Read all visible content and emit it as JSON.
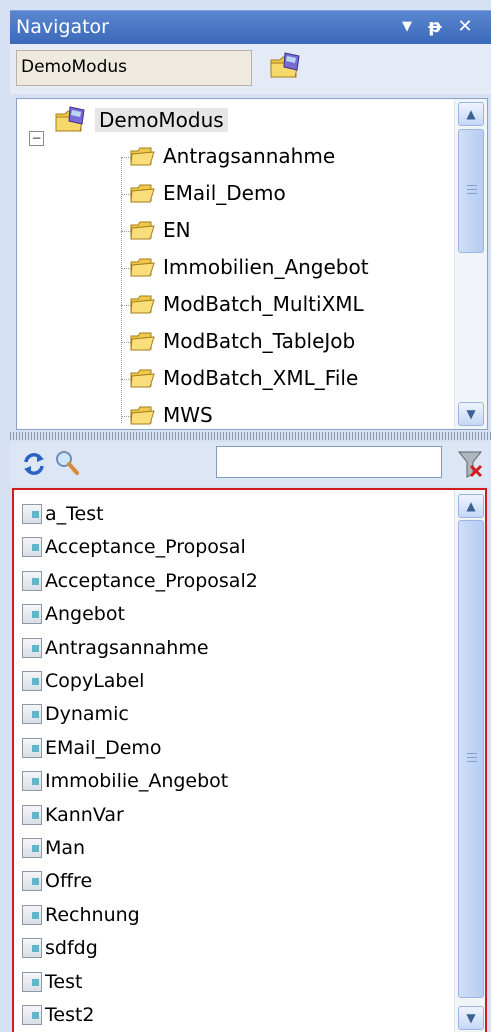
{
  "panel": {
    "title": "Navigator",
    "dropdown_glyph": "▼",
    "pin_glyph": "ᵽ",
    "close_glyph": "✕"
  },
  "combo": {
    "value": "DemoModus"
  },
  "tree": {
    "root": {
      "label": "DemoModus",
      "expander": "−"
    },
    "items": [
      "Antragsannahme",
      "EMail_Demo",
      "EN",
      "Immobilien_Angebot",
      "ModBatch_MultiXML",
      "ModBatch_TableJob",
      "ModBatch_XML_File",
      "MWS"
    ]
  },
  "toolbar": {
    "filter_value": "",
    "icons": [
      "refresh-icon",
      "search-icon",
      "clear-filter-icon"
    ]
  },
  "list": {
    "items": [
      "a_Test",
      "Acceptance_Proposal",
      "Acceptance_Proposal2",
      "Angebot",
      "Antragsannahme",
      "CopyLabel",
      "Dynamic",
      "EMail_Demo",
      "Immobilie_Angebot",
      "KannVar",
      "Man",
      "Offre",
      "Rechnung",
      "sdfdg",
      "Test",
      "Test2"
    ]
  },
  "colors": {
    "titlebar": "#3a68b9",
    "highlight_border": "#d21d1d",
    "folder": "#f0c94a",
    "doc_accent": "#5fb6c9"
  }
}
